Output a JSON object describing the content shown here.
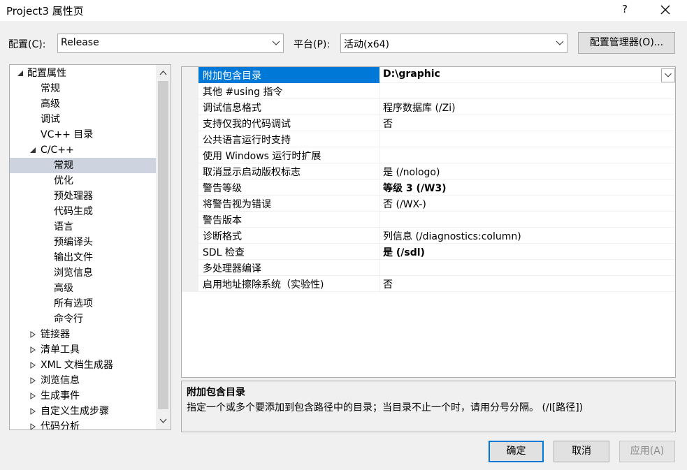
{
  "window": {
    "title": "Project3 属性页",
    "help": "?"
  },
  "config": {
    "config_label": "配置(C):",
    "config_value": "Release",
    "platform_label": "平台(P):",
    "platform_value": "活动(x64)",
    "manager_button": "配置管理器(O)..."
  },
  "tree": {
    "items": [
      {
        "label": "配置属性"
      },
      {
        "label": "常规"
      },
      {
        "label": "高级"
      },
      {
        "label": "调试"
      },
      {
        "label": "VC++ 目录"
      },
      {
        "label": "C/C++"
      },
      {
        "label": "常规"
      },
      {
        "label": "优化"
      },
      {
        "label": "预处理器"
      },
      {
        "label": "代码生成"
      },
      {
        "label": "语言"
      },
      {
        "label": "预编译头"
      },
      {
        "label": "输出文件"
      },
      {
        "label": "浏览信息"
      },
      {
        "label": "高级"
      },
      {
        "label": "所有选项"
      },
      {
        "label": "命令行"
      },
      {
        "label": "链接器"
      },
      {
        "label": "清单工具"
      },
      {
        "label": "XML 文档生成器"
      },
      {
        "label": "浏览信息"
      },
      {
        "label": "生成事件"
      },
      {
        "label": "自定义生成步骤"
      },
      {
        "label": "代码分析"
      }
    ]
  },
  "properties": [
    {
      "name": "附加包含目录",
      "value": "D:\\graphic"
    },
    {
      "name": "其他 #using 指令",
      "value": ""
    },
    {
      "name": "调试信息格式",
      "value": "程序数据库 (/Zi)"
    },
    {
      "name": "支持仅我的代码调试",
      "value": "否"
    },
    {
      "name": "公共语言运行时支持",
      "value": ""
    },
    {
      "name": "使用 Windows 运行时扩展",
      "value": ""
    },
    {
      "name": "取消显示启动版权标志",
      "value": "是 (/nologo)"
    },
    {
      "name": "警告等级",
      "value": "等级 3 (/W3)"
    },
    {
      "name": "将警告视为错误",
      "value": "否 (/WX-)"
    },
    {
      "name": "警告版本",
      "value": ""
    },
    {
      "name": "诊断格式",
      "value": "列信息 (/diagnostics:column)"
    },
    {
      "name": "SDL 检查",
      "value": "是 (/sdl)"
    },
    {
      "name": "多处理器编译",
      "value": ""
    },
    {
      "name": "启用地址擦除系统（实验性)",
      "value": "否"
    }
  ],
  "description": {
    "title": "附加包含目录",
    "text": "指定一个或多个要添加到包含路径中的目录；当目录不止一个时，请用分号分隔。     (/I[路径])"
  },
  "buttons": {
    "ok": "确定",
    "cancel": "取消",
    "apply": "应用(A)"
  },
  "colors": {
    "accent": "#0078d7",
    "tree_selection": "#cdd4df"
  }
}
